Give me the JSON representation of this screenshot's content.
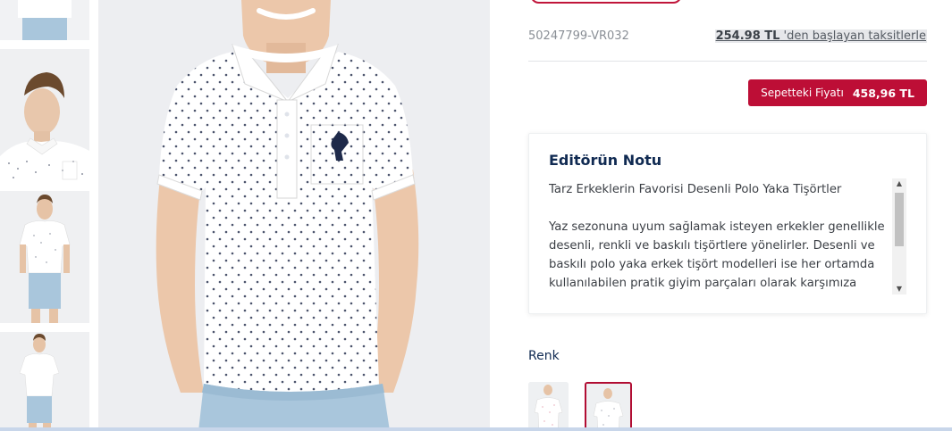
{
  "product": {
    "sku": "50247799-VR032",
    "installment_amount": "254.98 TL",
    "installment_text": " 'den başlayan taksitlerle",
    "cart_price_label": "Sepetteki Fiyatı",
    "cart_price_value": "458,96 TL"
  },
  "editor_note": {
    "title": "Editörün Notu",
    "paragraphs": [
      "Tarz Erkeklerin Favorisi Desenli Polo Yaka Tişörtler",
      "Yaz sezonuna uyum sağlamak isteyen erkekler genellikle desenli, renkli ve baskılı tişörtlere yönelirler. Desenli ve baskılı polo yaka erkek tişört modelleri ise her ortamda kullanılabilen pratik giyim parçaları olarak karşımıza çıkar."
    ]
  },
  "color_section": {
    "label": "Renk",
    "selected_index": 1
  },
  "colors": {
    "accent": "#bd0e36",
    "title_navy": "#102a52",
    "shirt_white": "#ffffff",
    "shorts_blue": "#a9c6dc",
    "background": "#edeef1"
  }
}
